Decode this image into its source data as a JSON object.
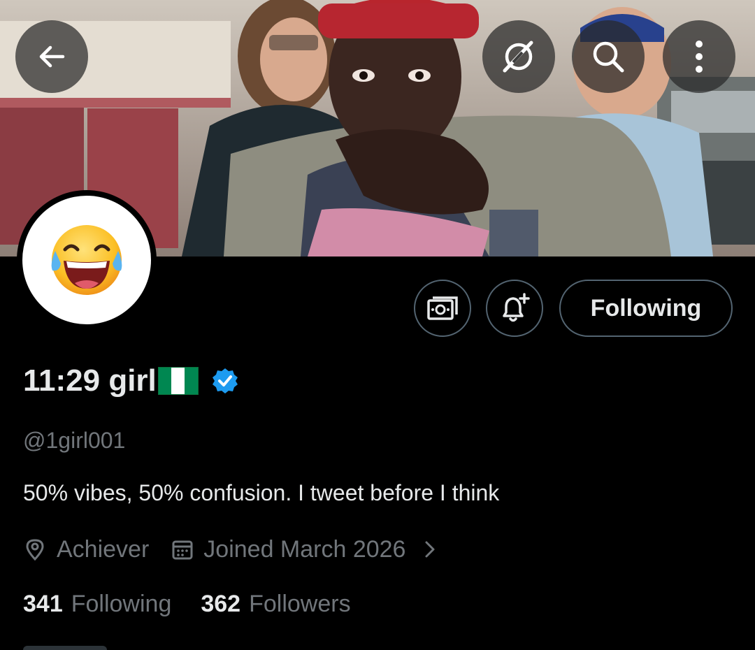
{
  "header": {
    "back_icon": "arrow-left-icon",
    "grok_icon": "grok-icon",
    "search_icon": "search-icon",
    "more_icon": "more-vertical-icon"
  },
  "profile": {
    "avatar_emoji": "😂",
    "display_name": "11:29 girl",
    "flag_colors": [
      "#008751",
      "#ffffff",
      "#008751"
    ],
    "verified_color": "#1d9bf0",
    "handle": "@1girl001",
    "bio": "50% vibes, 50% confusion. I tweet before I think",
    "location": "Achiever",
    "joined": "Joined March 2026",
    "following_count": "341",
    "following_label": "Following",
    "followers_count": "362",
    "followers_label": "Followers"
  },
  "actions": {
    "follow_label": "Following",
    "money_icon": "money-icon",
    "bell_icon": "notification-bell-plus-icon"
  },
  "colors": {
    "background": "#000000",
    "text_primary": "#e7e9ea",
    "text_secondary": "#71767b",
    "border": "#536471"
  }
}
